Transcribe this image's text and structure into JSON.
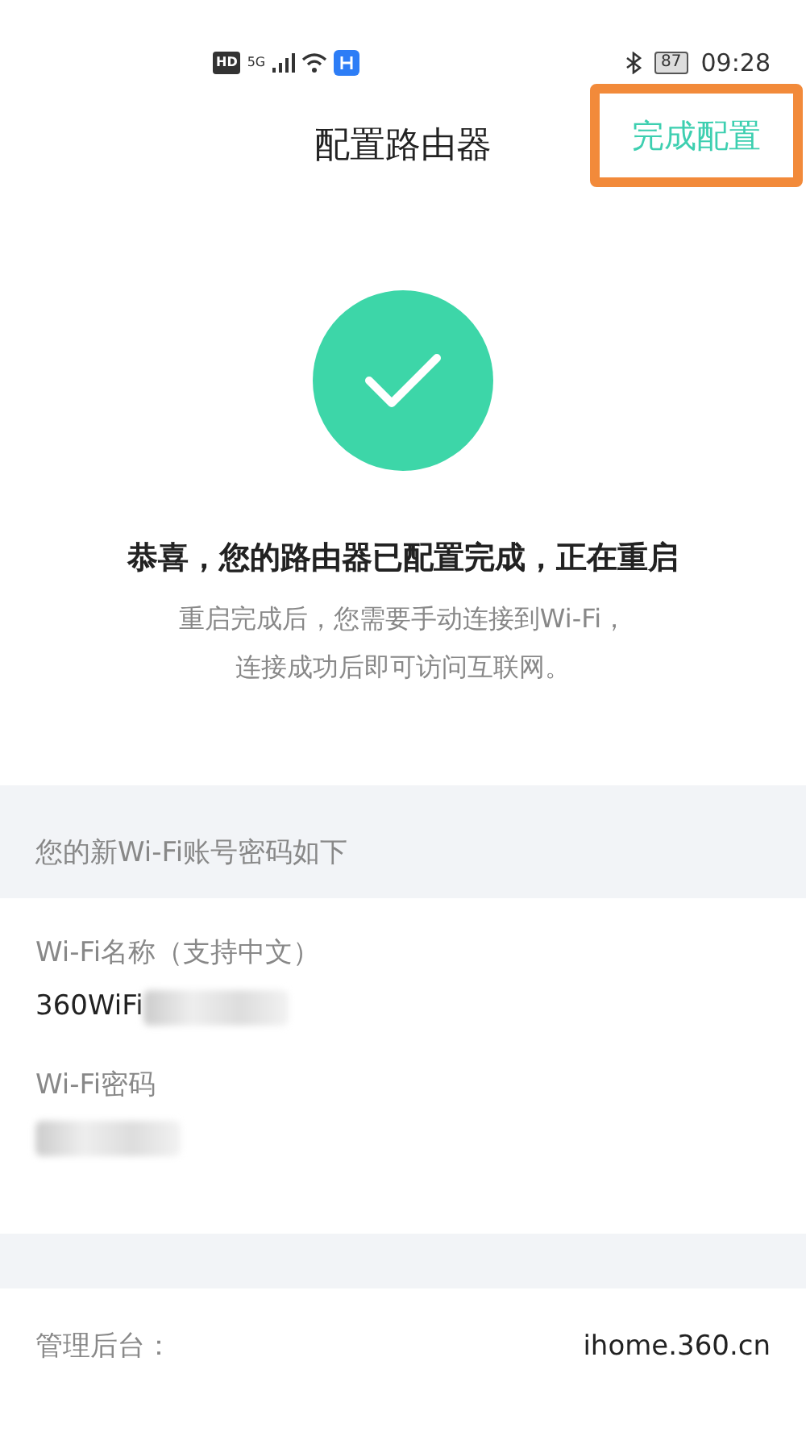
{
  "status_bar": {
    "time": "09:28",
    "battery": "87",
    "hd": "HD",
    "network": "5G"
  },
  "header": {
    "title": "配置路由器",
    "action": {
      "label": "完成配置",
      "highlighted": true
    }
  },
  "result": {
    "heading": "恭喜，您的路由器已配置完成，正在重启",
    "lines": [
      "重启完成后，您需要手动连接到Wi-Fi，",
      "连接成功后即可访问互联网。"
    ]
  },
  "wifi_section": {
    "title": "您的新Wi-Fi账号密码如下",
    "fields": [
      {
        "label": "Wi-Fi名称（支持中文）",
        "value": "360WiFi",
        "redacted": true
      },
      {
        "label": "Wi-Fi密码",
        "redacted": true
      }
    ]
  },
  "admin": {
    "label": "管理后台：",
    "value": "ihome.360.cn"
  }
}
